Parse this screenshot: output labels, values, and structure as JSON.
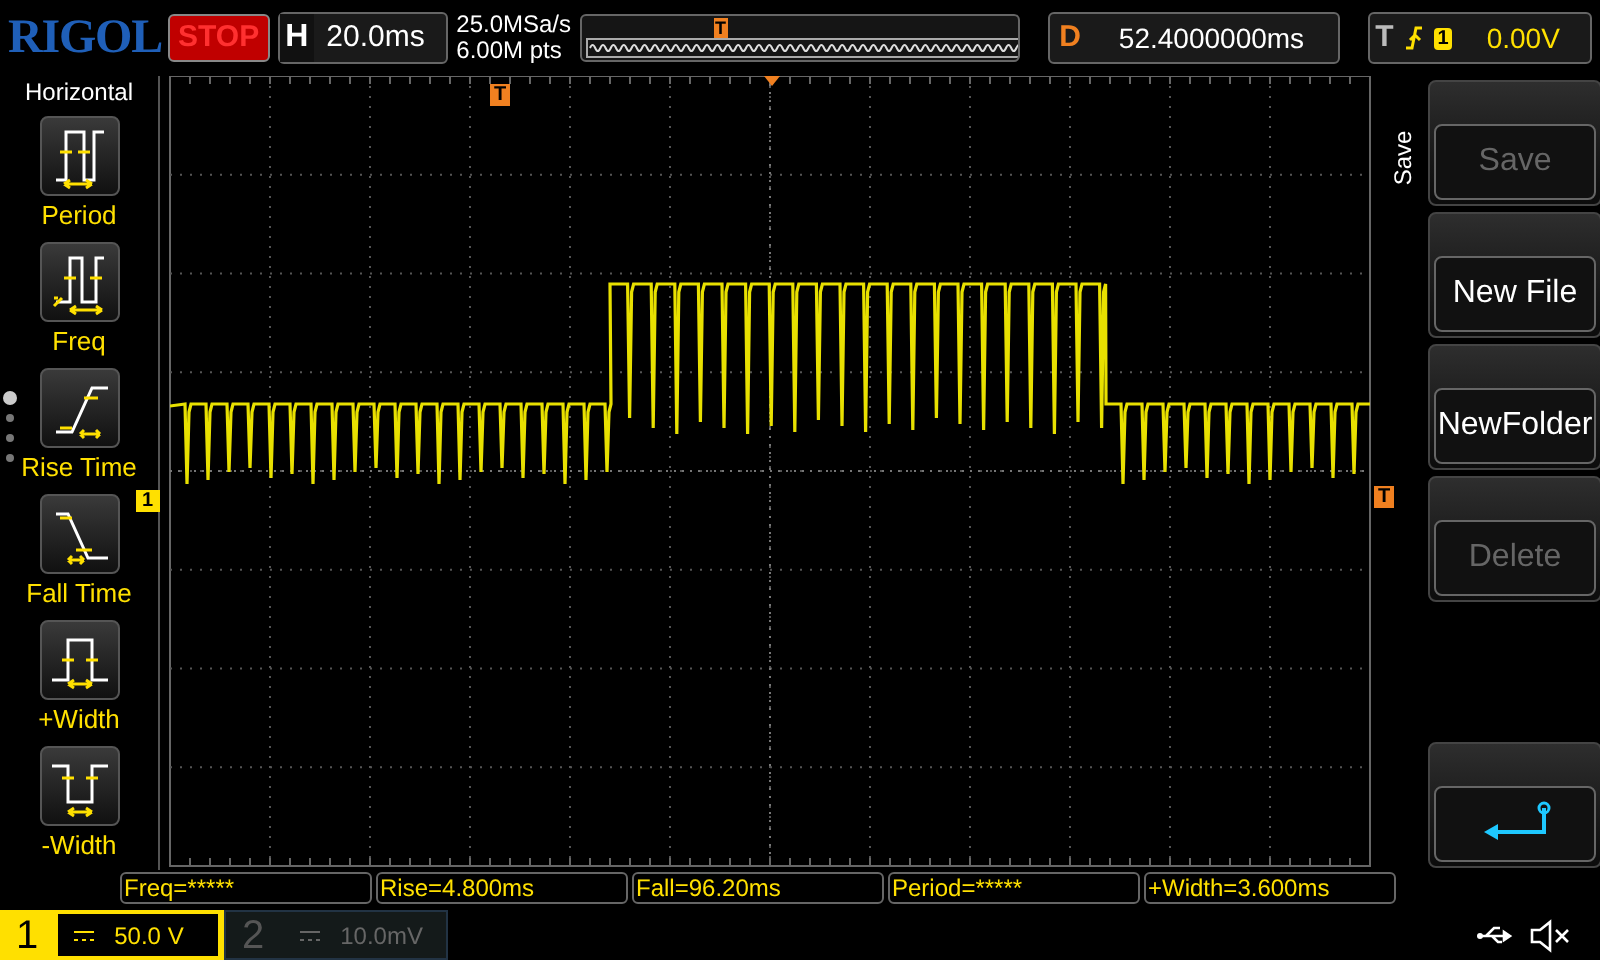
{
  "logo": "RIGOL",
  "run_state": "STOP",
  "timebase": {
    "label": "H",
    "value": "20.0ms"
  },
  "sample_rate": "25.0MSa/s",
  "memory_depth": "6.00M pts",
  "overview_marker": "T",
  "delay": {
    "label": "D",
    "value": "52.4000000ms"
  },
  "trigger": {
    "label": "T",
    "channel": "1",
    "level": "0.00V"
  },
  "left_menu": {
    "title": "Horizontal",
    "items": [
      {
        "label": "Period",
        "kind": "period"
      },
      {
        "label": "Freq",
        "kind": "freq"
      },
      {
        "label": "Rise Time",
        "kind": "rise"
      },
      {
        "label": "Fall Time",
        "kind": "fall"
      },
      {
        "label": "+Width",
        "kind": "pwidth"
      },
      {
        "label": "-Width",
        "kind": "nwidth"
      }
    ]
  },
  "grid_markers": {
    "trigger_position": "T",
    "channel": "1",
    "trigger_level": "T"
  },
  "right_menu": {
    "title": "Save",
    "items": [
      {
        "kind": "text",
        "label": "Save",
        "disabled": true
      },
      {
        "kind": "text",
        "label": "New File",
        "disabled": false
      },
      {
        "kind": "text",
        "label": "NewFolder",
        "disabled": false
      },
      {
        "kind": "text",
        "label": "Delete",
        "disabled": true
      },
      {
        "kind": "back"
      }
    ]
  },
  "measurements": [
    "Freq=*****",
    "Rise=4.800ms",
    "Fall=96.20ms",
    "Period=*****",
    "+Width=3.600ms"
  ],
  "channels": [
    {
      "number": "1",
      "scale": "50.0 V",
      "on": true
    },
    {
      "number": "2",
      "scale": "10.0mV",
      "on": false
    }
  ]
}
